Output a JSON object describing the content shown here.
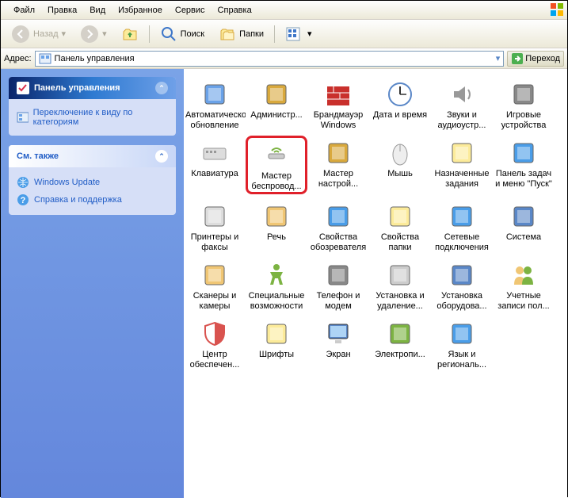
{
  "menu": [
    "Файл",
    "Правка",
    "Вид",
    "Избранное",
    "Сервис",
    "Справка"
  ],
  "toolbar": {
    "back": "Назад",
    "search": "Поиск",
    "folders": "Папки"
  },
  "address": {
    "label": "Адрес:",
    "value": "Панель управления",
    "go": "Переход"
  },
  "sidebar": {
    "panel1": {
      "title": "Панель управления",
      "links": [
        "Переключение к виду по категориям"
      ]
    },
    "panel2": {
      "title": "См. также",
      "links": [
        "Windows Update",
        "Справка и поддержка"
      ]
    }
  },
  "icons": [
    {
      "l": "Автоматическое обновление",
      "k": "update",
      "h": false
    },
    {
      "l": "Администр...",
      "k": "admin",
      "h": false
    },
    {
      "l": "Брандмауэр Windows",
      "k": "firewall",
      "h": false
    },
    {
      "l": "Дата и время",
      "k": "datetime",
      "h": false
    },
    {
      "l": "Звуки и аудиоустр...",
      "k": "sound",
      "h": false
    },
    {
      "l": "Игровые устройства",
      "k": "game",
      "h": false
    },
    {
      "l": "Клавиатура",
      "k": "keyboard",
      "h": false
    },
    {
      "l": "Мастер беспровод...",
      "k": "wireless",
      "h": true
    },
    {
      "l": "Мастер настрой...",
      "k": "netsetup",
      "h": false
    },
    {
      "l": "Мышь",
      "k": "mouse",
      "h": false
    },
    {
      "l": "Назначенные задания",
      "k": "tasks",
      "h": false
    },
    {
      "l": "Панель задач и меню \"Пуск\"",
      "k": "taskbar",
      "h": false
    },
    {
      "l": "Принтеры и факсы",
      "k": "printers",
      "h": false
    },
    {
      "l": "Речь",
      "k": "speech",
      "h": false
    },
    {
      "l": "Свойства обозревателя",
      "k": "inetopt",
      "h": false
    },
    {
      "l": "Свойства папки",
      "k": "folderopt",
      "h": false
    },
    {
      "l": "Сетевые подключения",
      "k": "netconn",
      "h": false
    },
    {
      "l": "Система",
      "k": "system",
      "h": false
    },
    {
      "l": "Сканеры и камеры",
      "k": "scanners",
      "h": false
    },
    {
      "l": "Специальные возможности",
      "k": "access",
      "h": false
    },
    {
      "l": "Телефон и модем",
      "k": "phone",
      "h": false
    },
    {
      "l": "Установка и удаление...",
      "k": "addremove",
      "h": false
    },
    {
      "l": "Установка оборудова...",
      "k": "addhw",
      "h": false
    },
    {
      "l": "Учетные записи пол...",
      "k": "users",
      "h": false
    },
    {
      "l": "Центр обеспечен...",
      "k": "security",
      "h": false
    },
    {
      "l": "Шрифты",
      "k": "fonts",
      "h": false
    },
    {
      "l": "Экран",
      "k": "display",
      "h": false
    },
    {
      "l": "Электропи...",
      "k": "power",
      "h": false
    },
    {
      "l": "Язык и региональ...",
      "k": "regional",
      "h": false
    }
  ]
}
